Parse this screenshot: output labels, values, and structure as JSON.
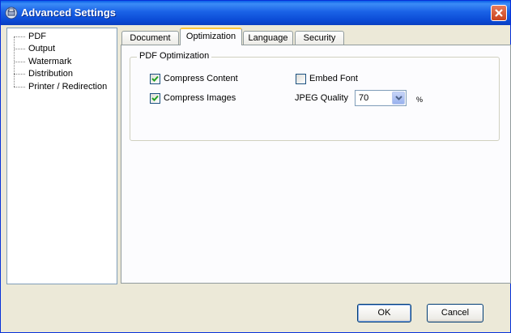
{
  "window": {
    "title": "Advanced Settings"
  },
  "tree": {
    "items": [
      "PDF",
      "Output",
      "Watermark",
      "Distribution",
      "Printer / Redirection"
    ]
  },
  "tabs": [
    "Document",
    "Optimization",
    "Language",
    "Security"
  ],
  "active_tab": "Optimization",
  "optimization": {
    "group_label": "PDF Optimization",
    "compress_content": {
      "label": "Compress Content",
      "checked": true
    },
    "compress_images": {
      "label": "Compress Images",
      "checked": true
    },
    "embed_font": {
      "label": "Embed Font",
      "checked": false
    },
    "jpeg_quality": {
      "label": "JPEG Quality",
      "value": "70",
      "unit": "%"
    }
  },
  "buttons": {
    "ok": "OK",
    "cancel": "Cancel"
  },
  "colors": {
    "titlebar": "#0A5FE8",
    "tab_highlight": "#FFC83C",
    "checkmark": "#21A121"
  }
}
